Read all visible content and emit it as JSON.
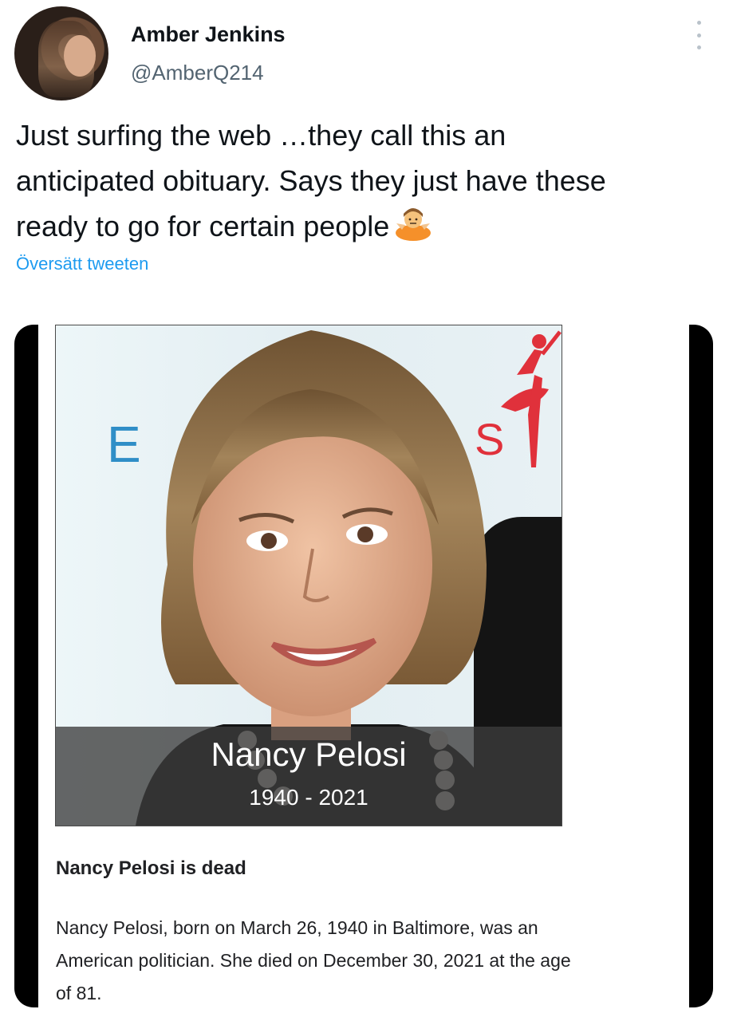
{
  "tweet": {
    "author": {
      "display_name": "Amber Jenkins",
      "handle": "@AmberQ214"
    },
    "text_lines": [
      "Just surfing the web …they call this an",
      "anticipated obituary. Says they just have these",
      "ready to go for certain people"
    ],
    "emoji": "person-shrugging",
    "translate_link": "Översätt tweeten"
  },
  "media": {
    "photo_caption": {
      "name": "Nancy Pelosi",
      "years": "1940 - 2021"
    },
    "article": {
      "headline": "Nancy Pelosi is dead",
      "body_lines": [
        "Nancy Pelosi, born on March 26, 1940 in Baltimore, was an",
        "American politician. She died on December 30, 2021 at the age",
        "of 81."
      ]
    }
  },
  "colors": {
    "link": "#1d9bf0",
    "handle": "#536471",
    "text": "#0f1419"
  }
}
